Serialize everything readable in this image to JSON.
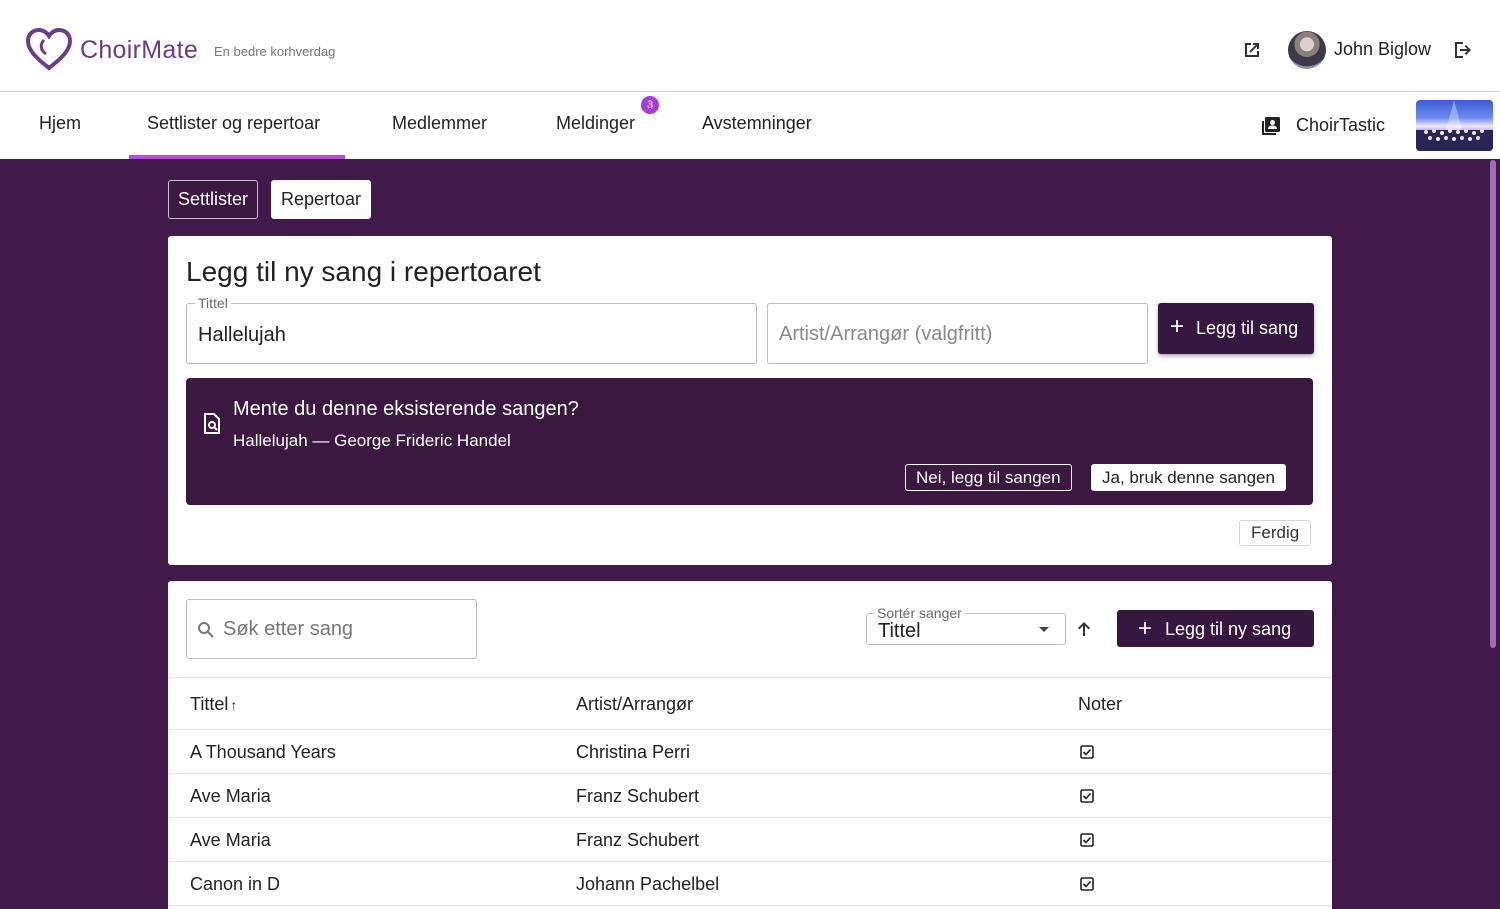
{
  "header": {
    "brand": "ChoirMate",
    "tagline": "En bedre korhverdag",
    "user_name": "John Biglow"
  },
  "nav": {
    "items": [
      {
        "label": "Hjem"
      },
      {
        "label": "Settlister og repertoar",
        "active": true
      },
      {
        "label": "Medlemmer"
      },
      {
        "label": "Meldinger",
        "badge": "3"
      },
      {
        "label": "Avstemninger"
      }
    ],
    "choir_name": "ChoirTastic"
  },
  "subnav": {
    "settlister": "Settlister",
    "repertoar": "Repertoar"
  },
  "add_song": {
    "heading": "Legg til ny sang i repertoaret",
    "title_label": "Tittel",
    "title_value": "Hallelujah",
    "artist_placeholder": "Artist/Arrangør (valgfritt)",
    "add_button": "Legg til sang",
    "suggestion": {
      "question": "Mente du denne eksisterende sangen?",
      "song": "Hallelujah — George Frideric Handel",
      "no_button": "Nei, legg til sangen",
      "yes_button": "Ja, bruk denne sangen"
    },
    "done_button": "Ferdig"
  },
  "song_list": {
    "search_placeholder": "Søk etter sang",
    "sort_label": "Sortér sanger",
    "sort_value": "Tittel",
    "new_song_button": "Legg til ny sang",
    "columns": {
      "title": "Tittel",
      "artist": "Artist/Arrangør",
      "notes": "Noter"
    },
    "rows": [
      {
        "title": "A Thousand Years",
        "artist": "Christina Perri",
        "has_notes": true
      },
      {
        "title": "Ave Maria",
        "artist": "Franz Schubert",
        "has_notes": true
      },
      {
        "title": "Ave Maria",
        "artist": "Franz Schubert",
        "has_notes": true
      },
      {
        "title": "Canon in D",
        "artist": "Johann Pachelbel",
        "has_notes": true
      }
    ]
  },
  "colors": {
    "brand_purple": "#6a3d86",
    "background_purple": "#421a49",
    "button_dark": "#36173f",
    "accent": "#b14fd9"
  }
}
